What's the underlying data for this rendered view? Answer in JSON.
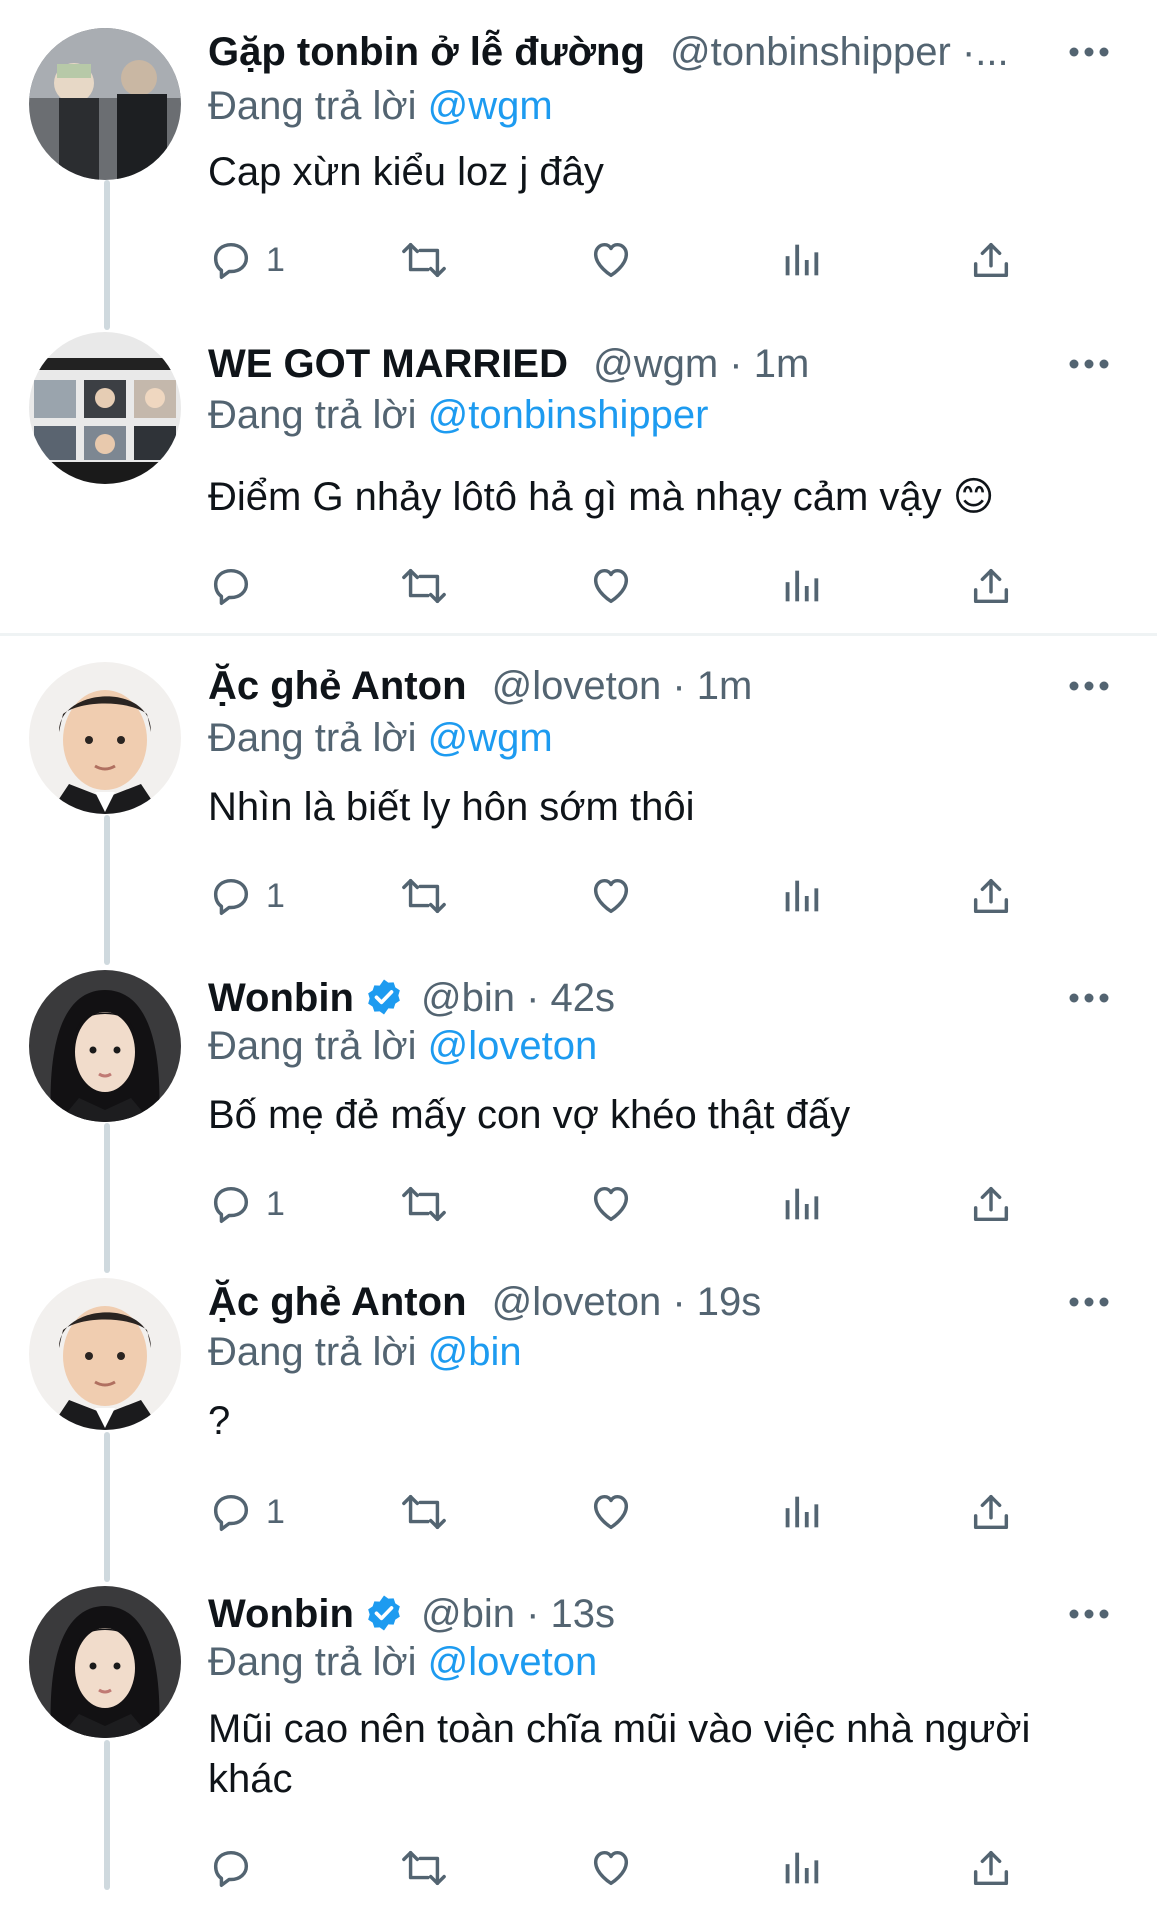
{
  "reply_prefix": "Đang trả lời",
  "tweets": [
    {
      "name": "Gặp tonbin ở lễ đường",
      "meta": "@tonbinshipper ·...",
      "mention": "@wgm",
      "text": "Cap xừn kiểu loz j đây",
      "reply_count": "1"
    },
    {
      "name": "WE GOT MARRIED",
      "meta": "@wgm · 1m",
      "mention": "@tonbinshipper",
      "text": "Điểm G nhảy lôtô hả gì mà nhạy cảm vậy 😊",
      "reply_count": ""
    },
    {
      "name": "Ặc ghẻ Anton",
      "meta": "@loveton · 1m",
      "mention": "@wgm",
      "text": "Nhìn là biết ly hôn sớm thôi",
      "reply_count": "1"
    },
    {
      "name": "Wonbin",
      "meta": "@bin · 42s",
      "mention": "@loveton",
      "text": "Bố mẹ đẻ mấy con vợ khéo thật đấy",
      "reply_count": "1"
    },
    {
      "name": "Ặc ghẻ Anton",
      "meta": "@loveton · 19s",
      "mention": "@bin",
      "text": "?",
      "reply_count": "1"
    },
    {
      "name": "Wonbin",
      "meta": "@bin · 13s",
      "mention": "@loveton",
      "text": "Mũi cao nên toàn chĩa mũi vào việc nhà người khác",
      "reply_count": ""
    }
  ],
  "colors": {
    "accent": "#1d9bf0",
    "secondary_text": "#536471",
    "thread_line": "#cfd9de"
  }
}
